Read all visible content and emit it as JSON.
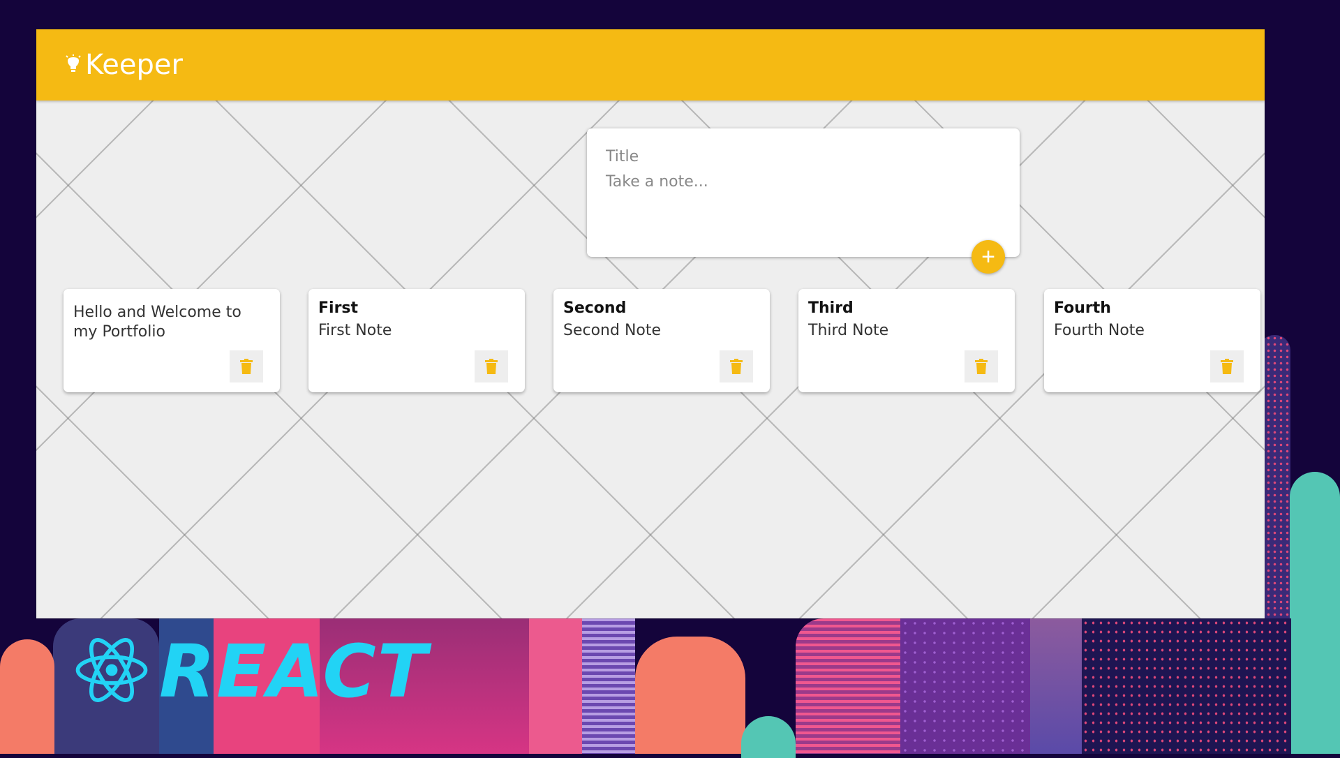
{
  "app": {
    "brand": "Keeper"
  },
  "create_area": {
    "title_placeholder": "Title",
    "content_placeholder": "Take a note...",
    "add_label": "+"
  },
  "notes": [
    {
      "title": "",
      "content": "Hello and Welcome to my Portfolio"
    },
    {
      "title": "First",
      "content": "First Note"
    },
    {
      "title": "Second",
      "content": "Second Note"
    },
    {
      "title": "Third",
      "content": "Third Note"
    },
    {
      "title": "Fourth",
      "content": "Fourth Note"
    }
  ],
  "banner": {
    "word": "REACT"
  },
  "colors": {
    "accent": "#f5ba13",
    "background": "#eeeeee",
    "page_bg": "#14043b",
    "react": "#22d3f5"
  },
  "icons": {
    "brand": "lightbulb-icon",
    "note_delete": "trash-icon",
    "add": "plus-icon",
    "react": "react-atom-icon"
  }
}
